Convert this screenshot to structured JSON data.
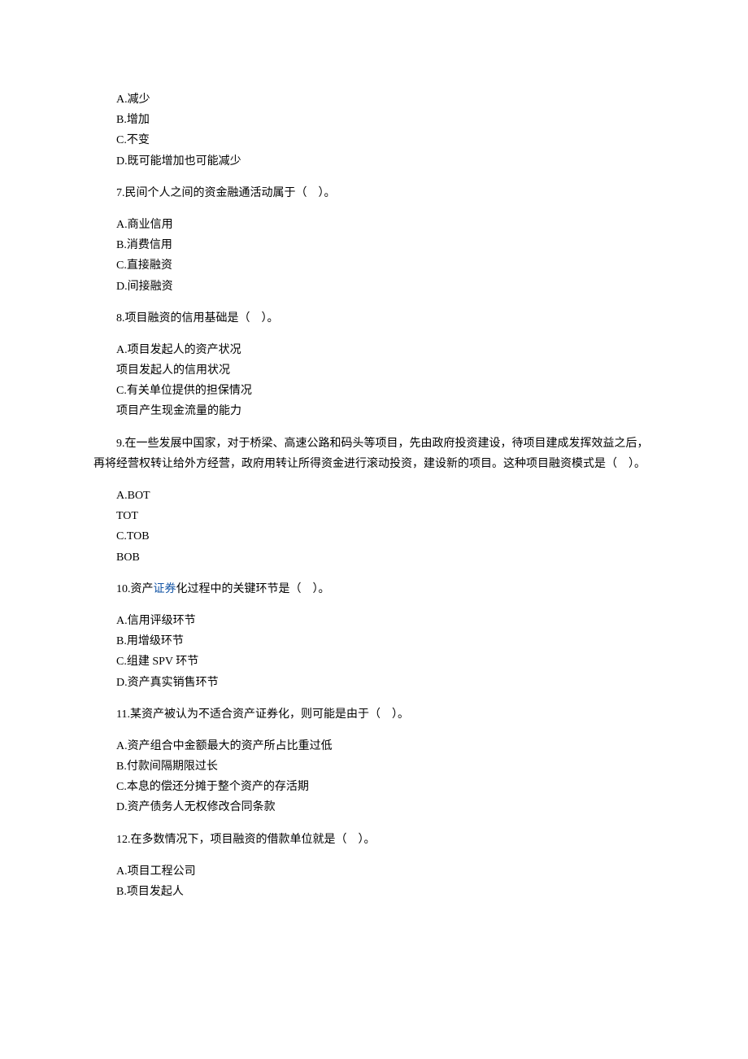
{
  "options6": {
    "a": "A.减少",
    "b": "B.增加",
    "c": "C.不变",
    "d": "D.既可能增加也可能减少"
  },
  "q7": "7.民间个人之间的资金融通活动属于（　）。",
  "options7": {
    "a": "A.商业信用",
    "b": "B.消费信用",
    "c": "C.直接融资",
    "d": "D.间接融资"
  },
  "q8": "8.项目融资的信用基础是（　）。",
  "options8": {
    "a": "A.项目发起人的资产状况",
    "b": "项目发起人的信用状况",
    "c": "C.有关单位提供的担保情况",
    "d": "项目产生现金流量的能力"
  },
  "q9": "9.在一些发展中国家，对于桥梁、高速公路和码头等项目，先由政府投资建设，待项目建成发挥效益之后，再将经营权转让给外方经营，政府用转让所得资金进行滚动投资，建设新的项目。这种项目融资模式是（　）。",
  "options9": {
    "a": "A.BOT",
    "b": "TOT",
    "c": "C.TOB",
    "d": "BOB"
  },
  "q10_prefix": "10.资产",
  "q10_link": "证券",
  "q10_suffix": "化过程中的关键环节是（　）。",
  "options10": {
    "a": "A.信用评级环节",
    "b": "B.用增级环节",
    "c": "C.组建 SPV 环节",
    "d": "D.资产真实销售环节"
  },
  "q11": "11.某资产被认为不适合资产证券化，则可能是由于（　）。",
  "options11": {
    "a": "A.资产组合中金额最大的资产所占比重过低",
    "b": "B.付款间隔期限过长",
    "c": "C.本息的偿还分摊于整个资产的存活期",
    "d": "D.资产债务人无权修改合同条款"
  },
  "q12": "12.在多数情况下，项目融资的借款单位就是（　）。",
  "options12": {
    "a": "A.项目工程公司",
    "b": "B.项目发起人"
  }
}
